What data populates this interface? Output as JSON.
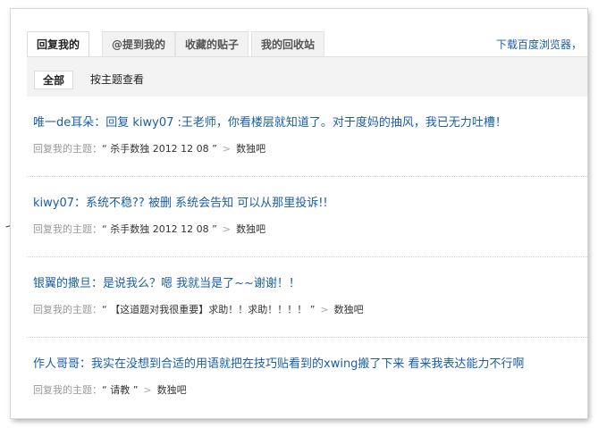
{
  "tabs": [
    {
      "label": "回复我的",
      "active": true
    },
    {
      "label": "@提到我的"
    },
    {
      "label": "收藏的贴子"
    },
    {
      "label": "我的回收站"
    }
  ],
  "download_link": "下载百度浏览器，",
  "subtabs": [
    {
      "label": "全部",
      "active": true
    },
    {
      "label": "按主题查看"
    }
  ],
  "meta_prefix": "回复我的主题：",
  "items": [
    {
      "reply": "唯一de耳朵：回复 kiwy07 :王老师，你看楼层就知道了。对于度妈的抽风，我已无力吐槽！",
      "topic": "“ 杀手数独 2012 12 08 ”",
      "forum": "数独吧"
    },
    {
      "reply": "kiwy07：系统不稳?? 被删 系统会告知 可以从那里投诉!!",
      "topic": "“ 杀手数独 2012 12 08 ”",
      "forum": "数独吧"
    },
    {
      "reply": "银翼的撒旦：是说我么？嗯 我就当是了~~谢谢！！",
      "topic": "“ 【这道题对我很重要】求助！！求助！！！！ ”",
      "forum": "数独吧"
    },
    {
      "reply": "作人哥哥：我实在没想到合适的用语就把在技巧贴看到的xwing搬了下来 看来我表达能力不行啊",
      "topic": "“ 请教 ”",
      "forum": "数独吧"
    }
  ],
  "arrow_glyph": ">",
  "colors": {
    "link": "#1a5ea8",
    "meta": "#999999",
    "subbar_bg": "#f3f3f3"
  }
}
